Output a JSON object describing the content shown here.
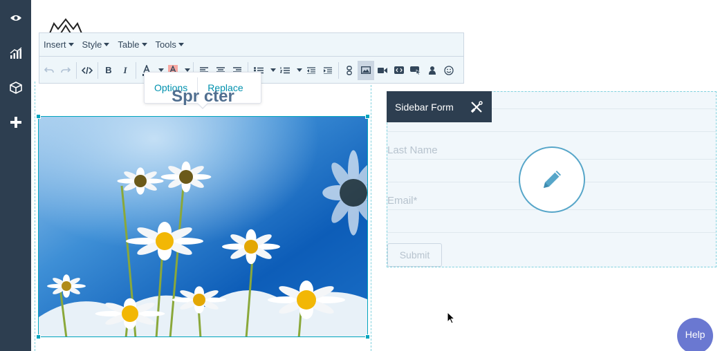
{
  "sidebar": {
    "icons": [
      "eye-icon",
      "chart-icon",
      "cube-icon",
      "plus-icon"
    ]
  },
  "toolbar": {
    "menus": [
      {
        "label": "Insert"
      },
      {
        "label": "Style"
      },
      {
        "label": "Table"
      },
      {
        "label": "Tools"
      }
    ],
    "text_color_swatch": "#33475b",
    "highlight_color_swatch": "#f2545b"
  },
  "popover": {
    "options_label": "Options",
    "replace_label": "Replace"
  },
  "content": {
    "heading": "Spr        cter"
  },
  "form": {
    "tag_label": "Sidebar Form",
    "last_name_label": "Last Name",
    "email_label": "Email*",
    "submit_label": "Submit"
  },
  "help": {
    "label": "Help"
  },
  "colors": {
    "sidebar_bg": "#2d3e50",
    "accent": "#00a4bd",
    "link": "#0091ae",
    "help_bg": "#6a78d1"
  }
}
